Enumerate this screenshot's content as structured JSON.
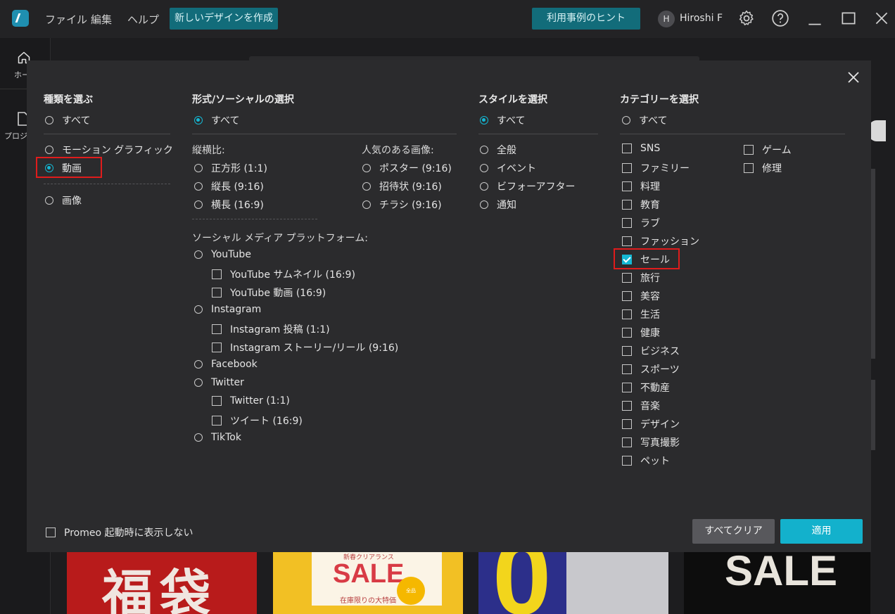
{
  "menu": {
    "file": "ファイル",
    "edit": "編集",
    "help": "ヘルプ"
  },
  "titlebar": {
    "create_button": "新しいデザインを作成",
    "hint_button": "利用事例のヒント",
    "avatar_initial": "H",
    "username": "Hiroshi F"
  },
  "sidebar": {
    "home_label": "ホー",
    "project_label": "プロジ"
  },
  "thumbnails": {
    "t1": "福袋",
    "t2_small": "新春クリアランス",
    "t2_big": "SALE",
    "t2_sub": "在庫限りの大特価",
    "t2_badge": "全品30%OFF",
    "t3": "0",
    "t4": "SALE"
  },
  "type_section": {
    "title": "種類を選ぶ",
    "all": "すべて",
    "motion": "モーション グラフィック",
    "video": "動画",
    "image": "画像",
    "selected": "動画"
  },
  "format_section": {
    "title": "形式/ソーシャルの選択",
    "all": "すべて",
    "ratio_title": "縦横比:",
    "ratios": [
      "正方形 (1:1)",
      "縦長 (9:16)",
      "横長 (16:9)"
    ],
    "popular_title": "人気のある画像:",
    "popular": [
      "ポスター (9:16)",
      "招待状 (9:16)",
      "チラシ (9:16)"
    ],
    "social_title": "ソーシャル メディア プラットフォーム:",
    "youtube": "YouTube",
    "youtube_thumb": "YouTube サムネイル (16:9)",
    "youtube_video": "YouTube 動画 (16:9)",
    "instagram": "Instagram",
    "instagram_post": "Instagram 投稿 (1:1)",
    "instagram_story": "Instagram ストーリー/リール (9:16)",
    "facebook": "Facebook",
    "twitter": "Twitter",
    "twitter_square": "Twitter (1:1)",
    "tweet": "ツイート (16:9)",
    "tiktok": "TikTok"
  },
  "style_section": {
    "title": "スタイルを選択",
    "all": "すべて",
    "styles": [
      "全般",
      "イベント",
      "ビフォーアフター",
      "通知"
    ]
  },
  "category_section": {
    "title": "カテゴリーを選択",
    "all": "すべて",
    "col1": [
      "SNS",
      "ファミリー",
      "料理",
      "教育",
      "ラブ",
      "ファッション",
      "セール",
      "旅行",
      "美容",
      "生活",
      "健康",
      "ビジネス",
      "スポーツ",
      "不動産",
      "音楽",
      "デザイン",
      "写真撮影",
      "ペット"
    ],
    "col2": [
      "ゲーム",
      "修理"
    ],
    "checked": "セール"
  },
  "footer": {
    "dont_show": "Promeo 起動時に表示しない",
    "clear_all": "すべてクリア",
    "apply": "適用"
  },
  "colors": {
    "accent": "#14b8d4",
    "highlight": "#e01c1c",
    "modal_bg": "#2b2b2d"
  }
}
